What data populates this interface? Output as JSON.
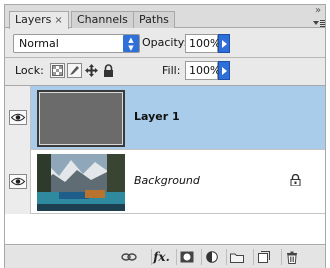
{
  "tabs": [
    {
      "label": "Layers",
      "close": "×"
    },
    {
      "label": "Channels"
    },
    {
      "label": "Paths"
    }
  ],
  "panel_controls": {
    "collapse": "»"
  },
  "blend": {
    "mode": "Normal",
    "opacity_label": "Opacity:",
    "opacity_value": "100%"
  },
  "lock": {
    "label": "Lock:",
    "fill_label": "Fill:",
    "fill_value": "100%"
  },
  "layers": [
    {
      "name": "Layer 1",
      "visible": true,
      "selected": true,
      "thumb_color": "#6b6b6b"
    },
    {
      "name": "Background",
      "visible": true,
      "selected": false,
      "locked": true
    }
  ],
  "colors": {
    "selection": "#a8cce9",
    "accent": "#2f6fd8"
  },
  "toolbar": [
    "link-icon",
    "fx-icon",
    "mask-icon",
    "adjustment-icon",
    "folder-icon",
    "new-layer-icon",
    "trash-icon"
  ],
  "toolbar_fx_label": "fx."
}
